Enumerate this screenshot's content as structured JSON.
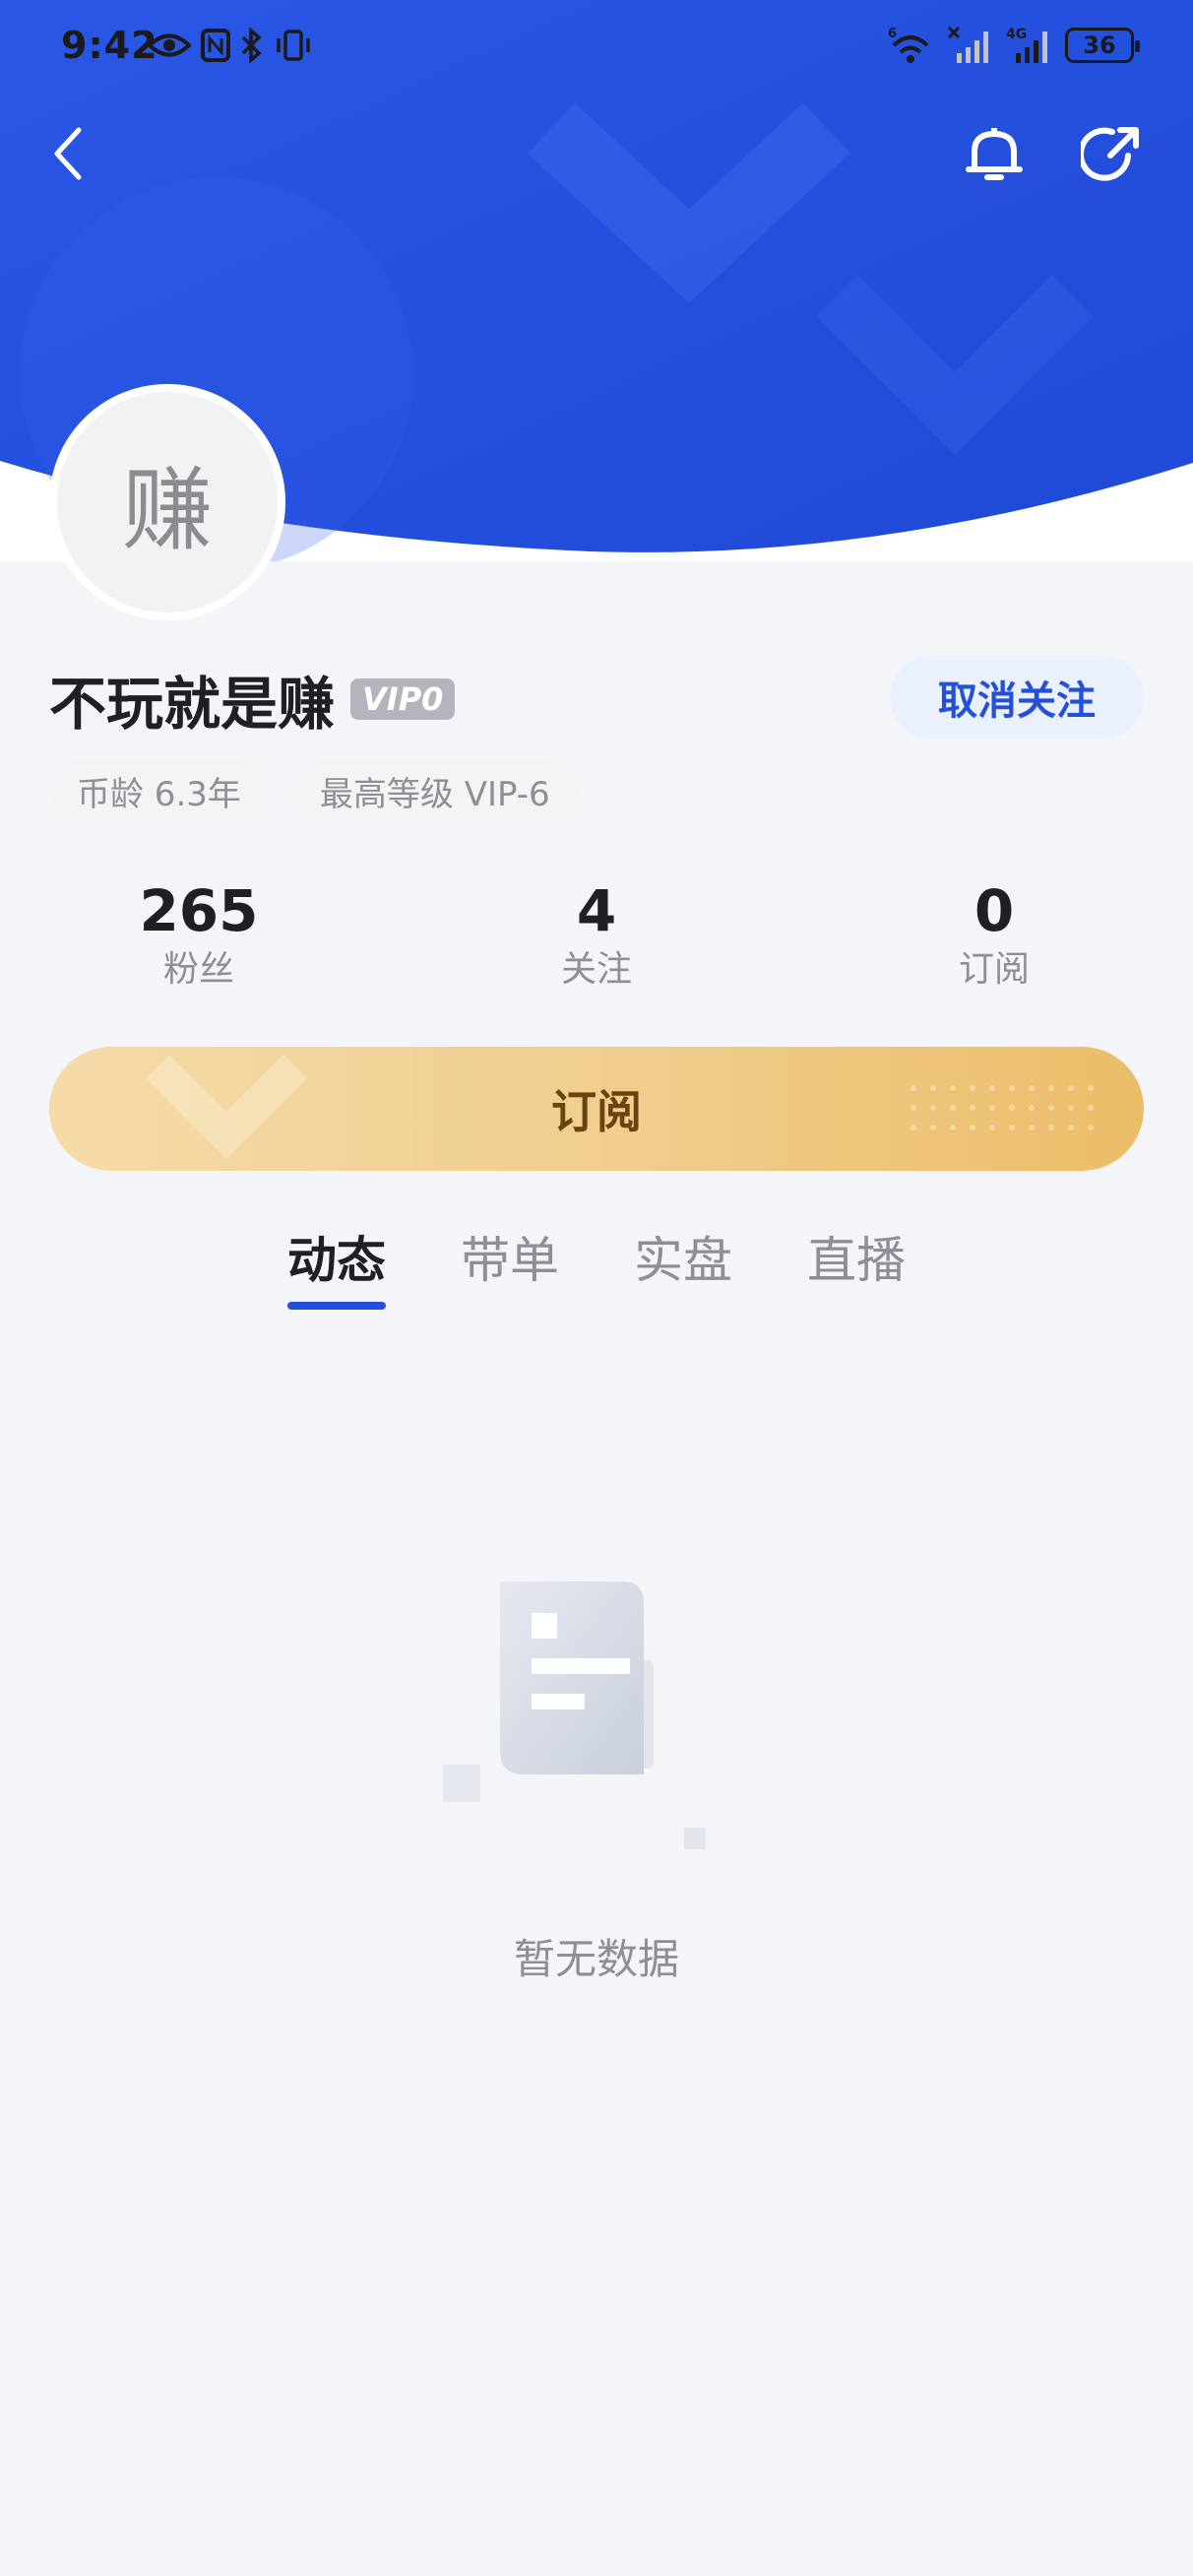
{
  "status_bar": {
    "time": "9:42",
    "battery": "36",
    "network_label": "4G",
    "wifi_label": "6"
  },
  "header": {
    "back_icon": "chevron-left-icon",
    "bell_icon": "bell-icon",
    "share_icon": "share-icon",
    "bg_color": "#2350d8"
  },
  "profile": {
    "avatar_char": "赚",
    "username": "不玩就是赚",
    "vip_badge": "VIP0",
    "unfollow_label": "取消关注",
    "chips": [
      "币龄 6.3年",
      "最高等级 VIP-6"
    ]
  },
  "stats": [
    {
      "value": "265",
      "label": "粉丝"
    },
    {
      "value": "4",
      "label": "关注"
    },
    {
      "value": "0",
      "label": "订阅"
    }
  ],
  "subscribe_label": "订阅",
  "tabs": [
    {
      "label": "动态",
      "active": true
    },
    {
      "label": "带单",
      "active": false
    },
    {
      "label": "实盘",
      "active": false
    },
    {
      "label": "直播",
      "active": false
    }
  ],
  "empty_state": {
    "text": "暂无数据",
    "icon": "empty-document-icon"
  },
  "colors": {
    "accent_blue": "#2350d8",
    "subscribe_gold": "#f0cf8f",
    "page_bg": "#f4f5f8"
  }
}
